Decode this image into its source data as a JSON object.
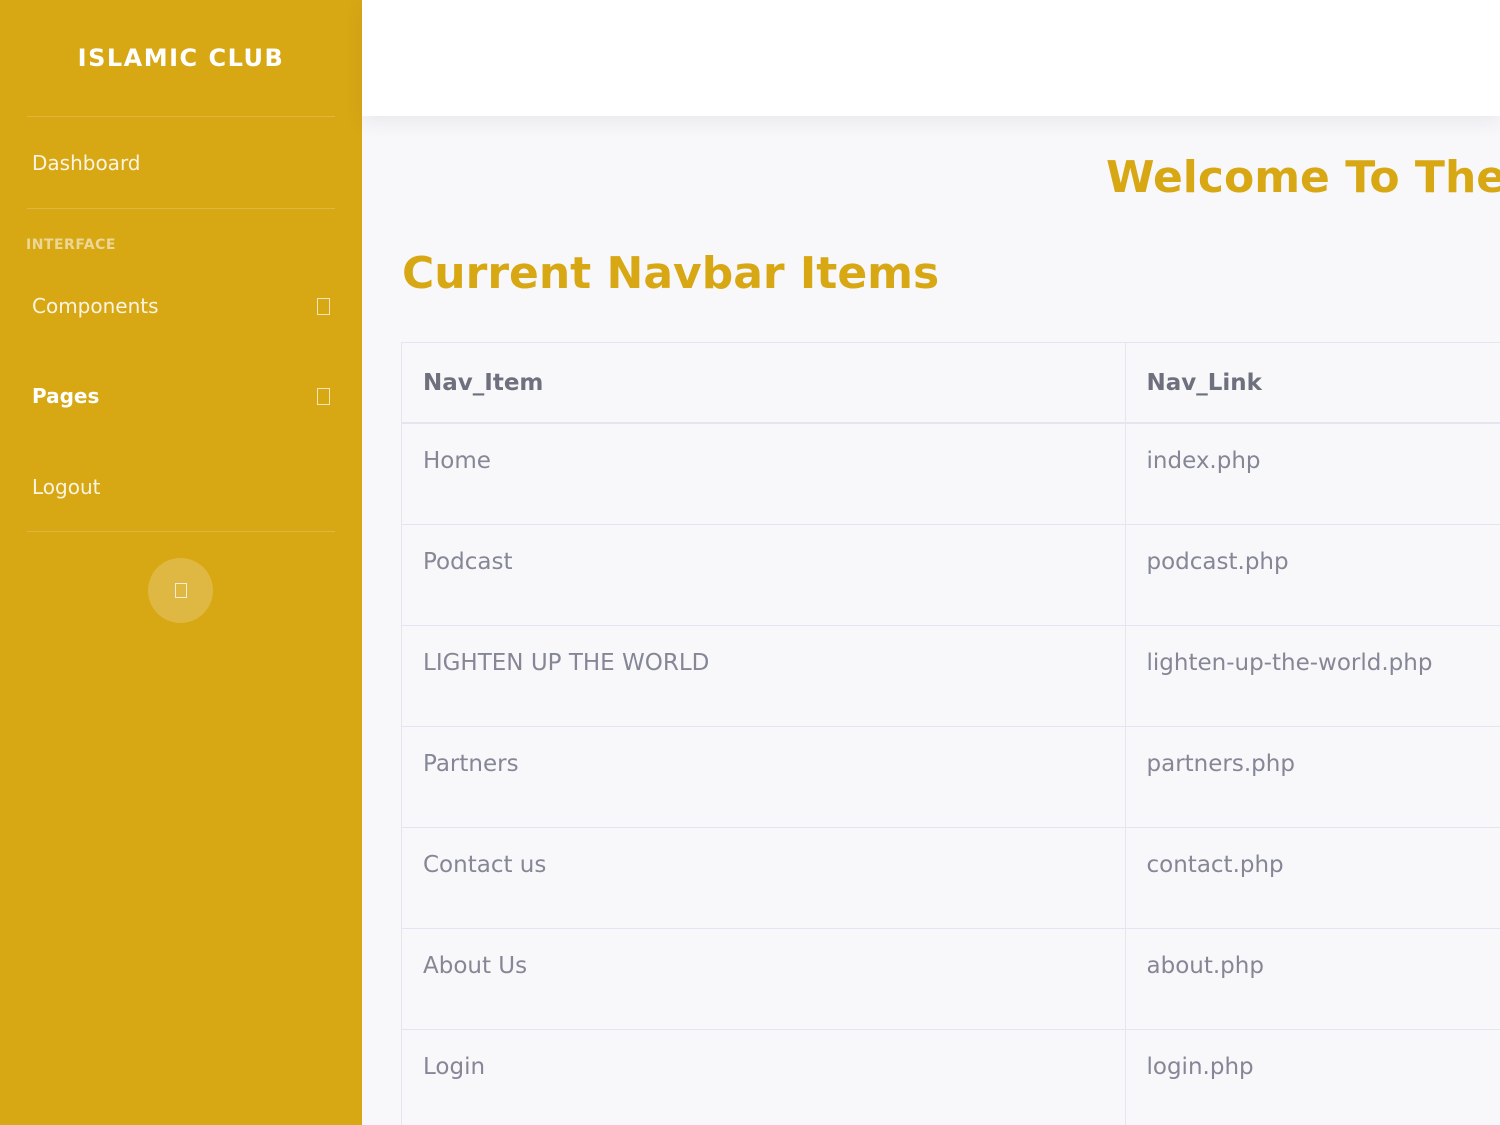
{
  "sidebar": {
    "brand": "ISLAMIC CLUB",
    "dashboard_label": "Dashboard",
    "section_heading": "INTERFACE",
    "components_label": "Components",
    "pages_label": "Pages",
    "logout_label": "Logout",
    "bg_color": "#d8a714"
  },
  "main": {
    "welcome_text": "Welcome To The D",
    "title": "Current Navbar Items",
    "table": {
      "headers": [
        "Nav_Item",
        "Nav_Link"
      ],
      "rows": [
        [
          "Home",
          "index.php"
        ],
        [
          "Podcast",
          "podcast.php"
        ],
        [
          "LIGHTEN UP THE WORLD",
          "lighten-up-the-world.php"
        ],
        [
          "Partners",
          "partners.php"
        ],
        [
          "Contact us",
          "contact.php"
        ],
        [
          "About Us",
          "about.php"
        ],
        [
          "Login",
          "login.php"
        ]
      ]
    },
    "accent_color": "#d8a714"
  }
}
